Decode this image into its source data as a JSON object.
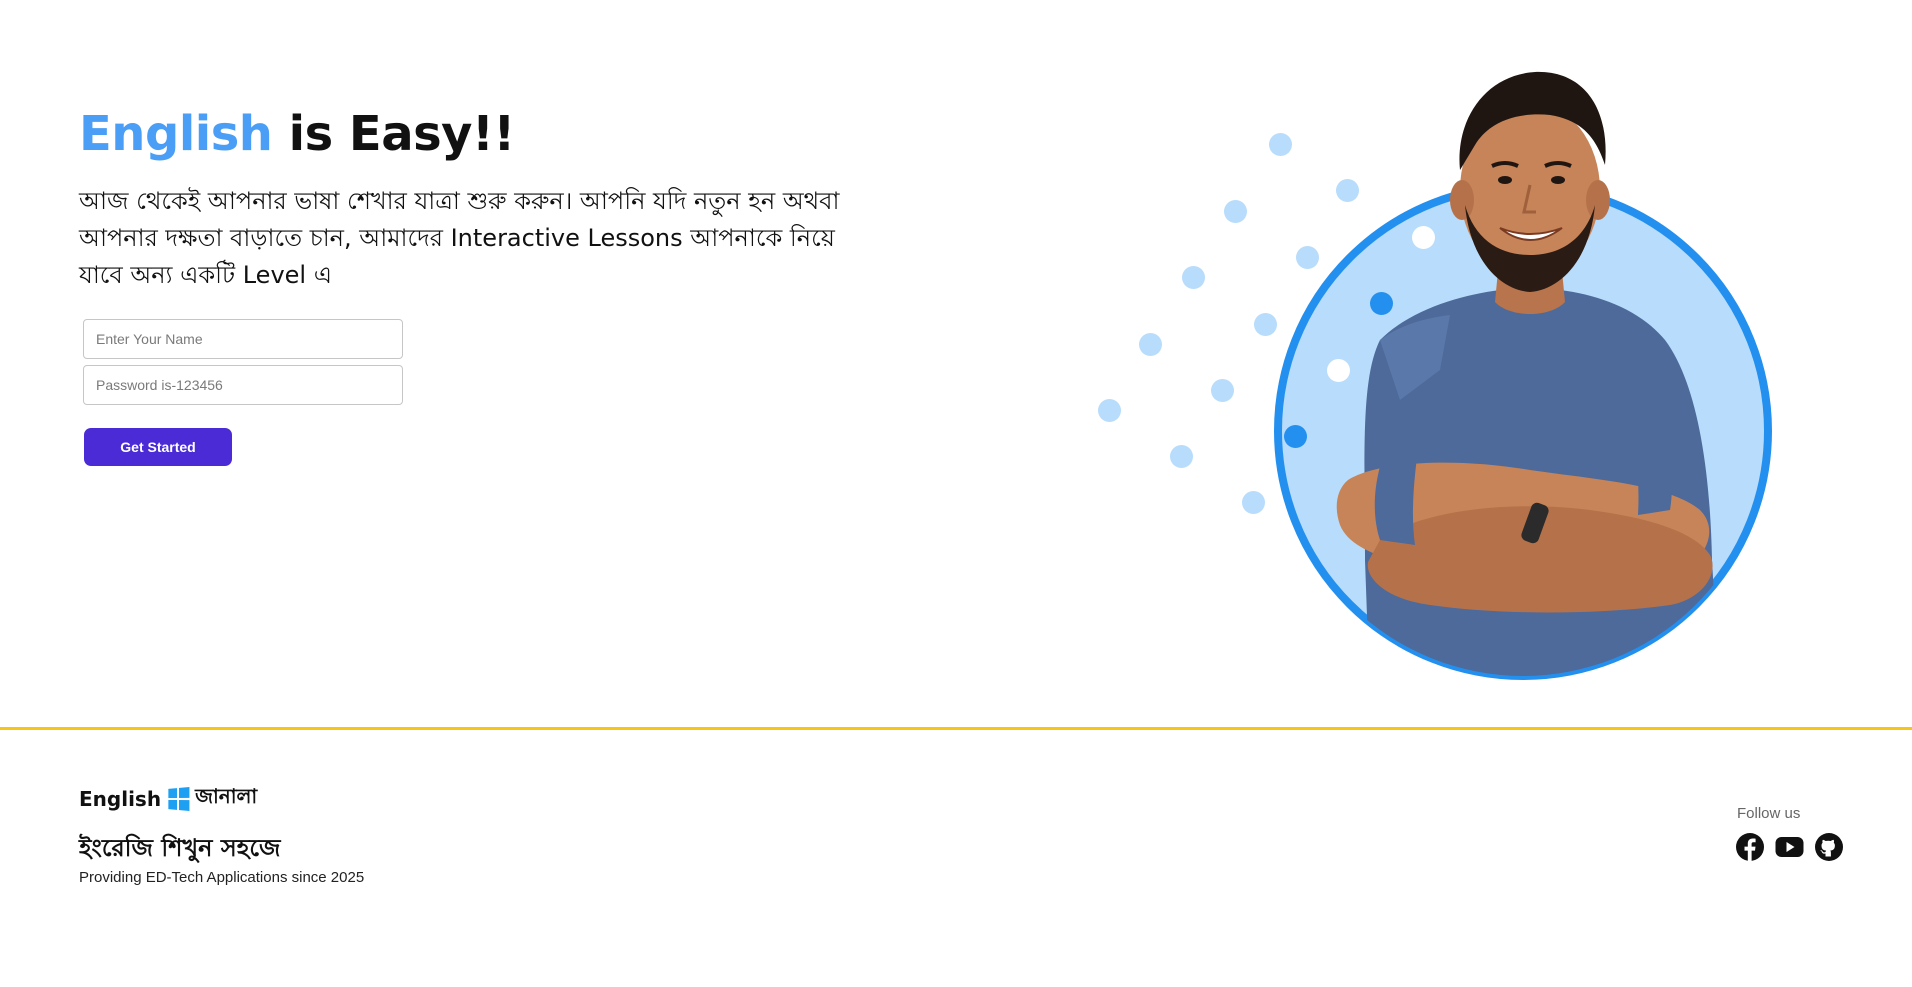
{
  "hero": {
    "title_accent": "English",
    "title_rest": " is Easy!!",
    "description": "আজ থেকেই আপনার ভাষা শেখার যাত্রা শুরু করুন। আপনি যদি নতুন হন অথবা আপনার দক্ষতা বাড়াতে চান, আমাদের Interactive Lessons আপনাকে নিয়ে যাবে অন্য একটি Level এ",
    "colors": {
      "accent": "#4a9ef5",
      "button": "#4a2bd6",
      "circle_fill": "#b8dcfb",
      "circle_border": "#2390ef"
    }
  },
  "form": {
    "name_placeholder": "Enter Your Name",
    "password_placeholder": "Password is-123456",
    "submit_label": "Get Started"
  },
  "illustration": {
    "image": "smiling-man-with-crossed-arms",
    "decoration": "dot-pattern"
  },
  "footer": {
    "brand_english": "English",
    "brand_icon": "windows-icon",
    "brand_bangla": "জানালা",
    "tagline": "ইংরেজি শিখুন সহজে",
    "since": "Providing ED-Tech Applications since 2025",
    "follow_label": "Follow us",
    "social": [
      "facebook-icon",
      "youtube-icon",
      "github-icon"
    ],
    "divider_color": "#f5c518"
  }
}
